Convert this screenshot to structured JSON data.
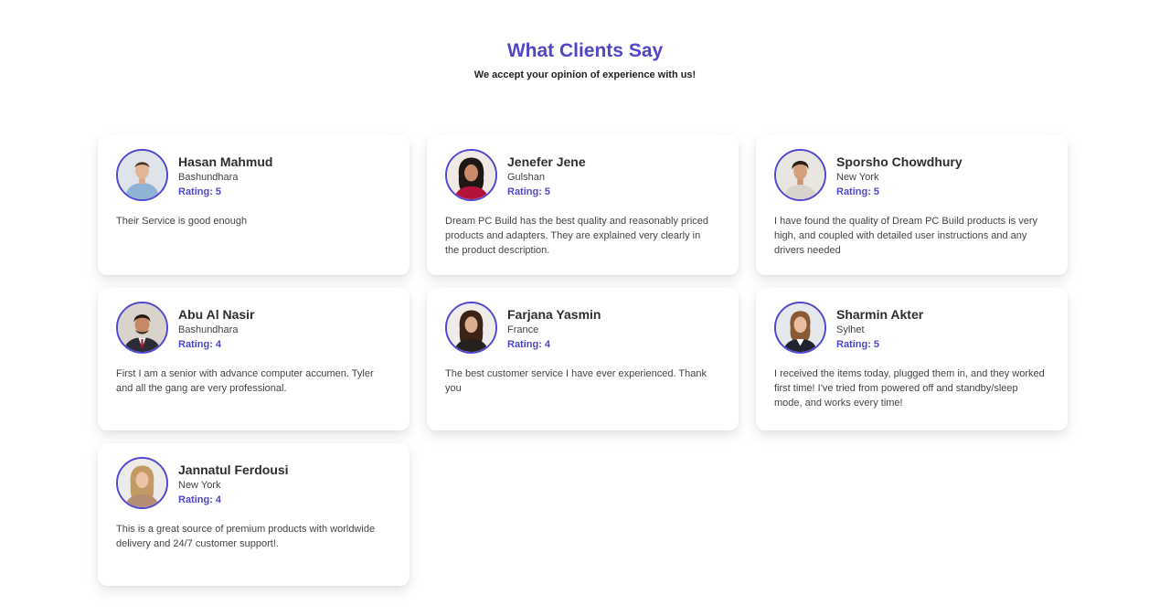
{
  "header": {
    "title": "What Clients Say",
    "subtitle": "We accept your opinion of experience with us!"
  },
  "rating_label": "Rating:",
  "accent_color": "#4f46c8",
  "testimonials": [
    {
      "name": "Hasan Mahmud",
      "location": "Bashundhara",
      "rating": "5",
      "text": "Their Service is good enough",
      "avatar": "man-casual-avatar"
    },
    {
      "name": "Jenefer Jene",
      "location": "Gulshan",
      "rating": "5",
      "text": "Dream PC Build has the best quality and reasonably priced products and adapters. They are explained very clearly in the product description.",
      "avatar": "woman-dark-hair-avatar"
    },
    {
      "name": "Sporsho Chowdhury",
      "location": "New York",
      "rating": "5",
      "text": "I have found the quality of Dream PC Build products is very high, and coupled with detailed user instructions and any drivers needed",
      "avatar": "man-smiling-avatar"
    },
    {
      "name": "Abu Al Nasir",
      "location": "Bashundhara",
      "rating": "4",
      "text": "First I am a senior with advance computer accumen. Tyler and all the gang are very professional.",
      "avatar": "man-suit-avatar"
    },
    {
      "name": "Farjana Yasmin",
      "location": "France",
      "rating": "4",
      "text": "The best customer service I have ever experienced. Thank you",
      "avatar": "woman-long-hair-avatar"
    },
    {
      "name": "Sharmin Akter",
      "location": "Sylhet",
      "rating": "5",
      "text": "I received the items today, plugged them in, and they worked first time! I've tried from powered off and standby/sleep mode, and works every time!",
      "avatar": "woman-blazer-avatar"
    },
    {
      "name": "Jannatul Ferdousi",
      "location": "New York",
      "rating": "4",
      "text": "This is a great source of premium products with worldwide delivery and 24/7 customer support!.",
      "avatar": "woman-blonde-avatar"
    }
  ]
}
